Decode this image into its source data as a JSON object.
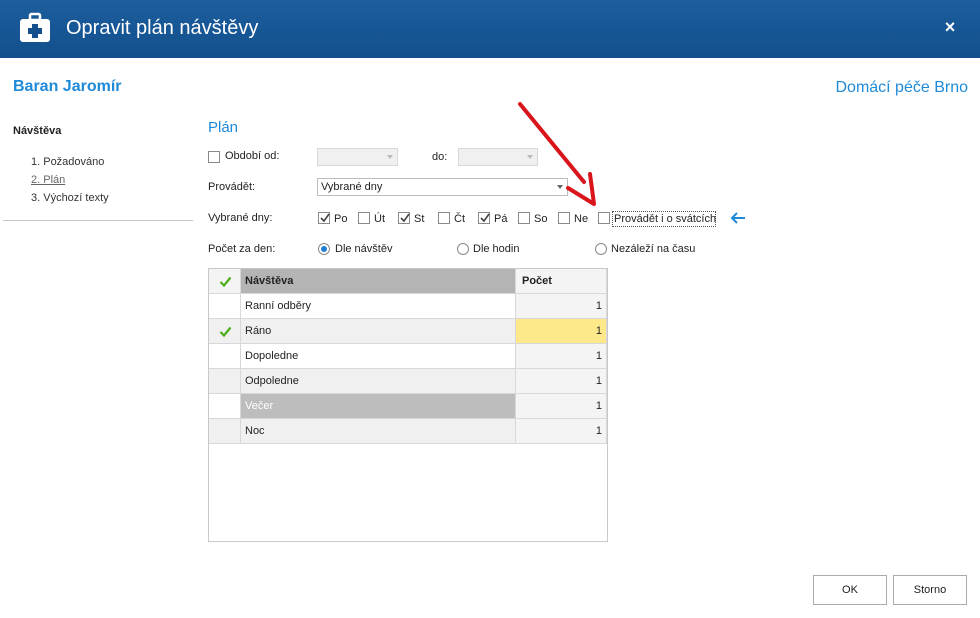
{
  "window": {
    "title": "Opravit plán návštěvy",
    "close_glyph": "×"
  },
  "header": {
    "client_name": "Baran Jaromír",
    "organization": "Domácí péče Brno"
  },
  "nav": {
    "heading": "Návštěva",
    "items": [
      {
        "label": "1. Požadováno"
      },
      {
        "label": "2. Plán"
      },
      {
        "label": "3. Výchozí texty"
      }
    ]
  },
  "plan": {
    "title": "Plán",
    "period_label": "Období od:",
    "period_checked": false,
    "to_label": "do:",
    "perform_label": "Provádět:",
    "perform_value": "Vybrané dny",
    "days_label": "Vybrané dny:",
    "days": [
      {
        "label": "Po",
        "checked": true
      },
      {
        "label": "Út",
        "checked": false
      },
      {
        "label": "St",
        "checked": true
      },
      {
        "label": "Čt",
        "checked": false
      },
      {
        "label": "Pá",
        "checked": true
      },
      {
        "label": "So",
        "checked": false
      },
      {
        "label": "Ne",
        "checked": false
      }
    ],
    "holidays_label": "Provádět i o svátcích",
    "holidays_checked": false,
    "count_label": "Počet za den:",
    "count_options": [
      {
        "label": "Dle návštěv",
        "selected": true
      },
      {
        "label": "Dle hodin",
        "selected": false
      },
      {
        "label": "Nezáleží na času",
        "selected": false
      }
    ]
  },
  "grid": {
    "columns": [
      "Návštěva",
      "Počet"
    ],
    "rows": [
      {
        "name": "Ranní odběry",
        "count": "1",
        "checked": false
      },
      {
        "name": "Ráno",
        "count": "1",
        "checked": true
      },
      {
        "name": "Dopoledne",
        "count": "1",
        "checked": false
      },
      {
        "name": "Odpoledne",
        "count": "1",
        "checked": false
      },
      {
        "name": "Večer",
        "count": "1",
        "checked": false
      },
      {
        "name": "Noc",
        "count": "1",
        "checked": false
      }
    ]
  },
  "buttons": {
    "ok": "OK",
    "cancel": "Storno"
  },
  "colors": {
    "title_bar": "#124f8c",
    "accent": "#1f8ad8",
    "check_green": "#4caf1a",
    "annotation_red": "#d9141b",
    "edit_cell": "#fde98a"
  }
}
